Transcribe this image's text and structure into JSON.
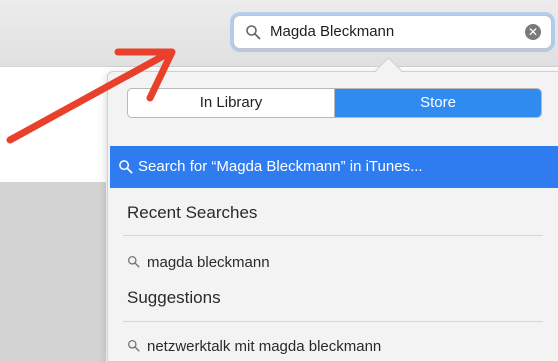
{
  "search": {
    "query": "Magda Bleckmann"
  },
  "scope": {
    "in_library": "In Library",
    "store": "Store",
    "selected": "Store"
  },
  "top_result": {
    "label": "Search for “Magda Bleckmann” in iTunes..."
  },
  "recent": {
    "title": "Recent Searches",
    "items": [
      "magda bleckmann"
    ]
  },
  "suggestions": {
    "title": "Suggestions",
    "items": [
      "netzwerktalk mit magda bleckmann"
    ]
  },
  "colors": {
    "accent": "#2f7cf0",
    "annotation_arrow": "#e8402a"
  },
  "icons": {
    "search": "magnifier-icon",
    "clear": "clear-circle-icon",
    "annotation": "red-arrow-icon"
  }
}
